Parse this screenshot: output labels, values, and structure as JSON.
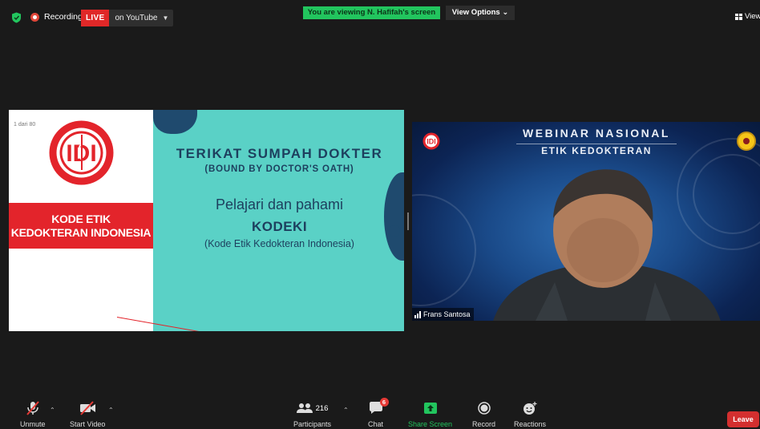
{
  "top_bar": {
    "recording_label": "Recording",
    "live_badge": "LIVE",
    "live_platform": "on YouTube",
    "viewing_banner": "You are viewing N. Hafifah's screen",
    "view_options_label": "View Options",
    "view_label": "View"
  },
  "slide": {
    "page_indicator": "1 dari 80",
    "logo_text": "IDI",
    "band_line1": "KODE ETIK",
    "band_line2": "KEDOKTERAN INDONESIA",
    "title": "TERIKAT SUMPAH DOKTER",
    "subtitle": "(BOUND BY DOCTOR'S OATH)",
    "line1": "Pelajari dan pahami",
    "line2": "KODEKI",
    "line3": "(Kode Etik Kedokteran Indonesia)"
  },
  "video": {
    "banner_title": "WEBINAR NASIONAL",
    "banner_subtitle": "ETIK KEDOKTERAN",
    "participant_name": "Frans Santosa"
  },
  "toolbar": {
    "unmute_label": "Unmute",
    "start_video_label": "Start Video",
    "participants_label": "Participants",
    "participants_count": "216",
    "chat_label": "Chat",
    "chat_badge": "6",
    "share_screen_label": "Share Screen",
    "record_label": "Record",
    "reactions_label": "Reactions",
    "leave_label": "Leave"
  },
  "colors": {
    "background": "#1a1a1a",
    "live_red": "#e02828",
    "banner_green": "#22c55e",
    "slide_teal": "#5ad1c6",
    "slide_navy": "#1d3f5e",
    "idi_red": "#e3242b",
    "leave_red": "#d32f2f"
  }
}
